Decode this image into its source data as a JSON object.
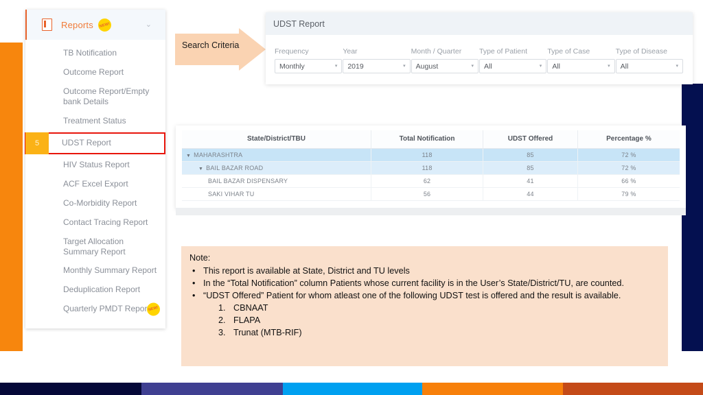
{
  "decor": {
    "left_bar_color": "#F7860D",
    "right_panel_color": "#041050",
    "bottom_strip_colors": [
      "#050838",
      "#3F3F91",
      "#00A0F0",
      "#F7800B",
      "#C44A18"
    ]
  },
  "sidebar": {
    "header": {
      "title": "Reports",
      "badge": "NEW!",
      "icon": "report-icon",
      "chevron": "⌄"
    },
    "items": [
      {
        "label": "TB Notification",
        "highlight": false
      },
      {
        "label": "Outcome Report",
        "highlight": false
      },
      {
        "label": "Outcome Report/Empty bank Details",
        "highlight": false
      },
      {
        "label": "Treatment Status",
        "highlight": false
      },
      {
        "label": "UDST Report",
        "highlight": true,
        "number": "5"
      },
      {
        "label": "HIV Status Report",
        "highlight": false
      },
      {
        "label": "ACF Excel Export",
        "highlight": false
      },
      {
        "label": "Co-Morbidity Report",
        "highlight": false
      },
      {
        "label": "Contact Tracing Report",
        "highlight": false
      },
      {
        "label": "Target Allocation Summary Report",
        "highlight": false
      },
      {
        "label": "Monthly Summary Report",
        "highlight": false
      },
      {
        "label": "Deduplication Report",
        "highlight": false
      },
      {
        "label": "Quarterly PMDT Report",
        "highlight": false,
        "badge": "NEW!"
      }
    ]
  },
  "annotation": {
    "search_criteria_label": "Search Criteria",
    "arrow_color": "#FAD3B2"
  },
  "report_card": {
    "title": "UDST Report",
    "filters": [
      {
        "label": "Frequency",
        "value": "Monthly"
      },
      {
        "label": "Year",
        "value": "2019"
      },
      {
        "label": "Month / Quarter",
        "value": "August"
      },
      {
        "label": "Type of Patient",
        "value": "All"
      },
      {
        "label": "Type of Case",
        "value": "All"
      },
      {
        "label": "Type of Disease",
        "value": "All"
      }
    ],
    "caret": "▾"
  },
  "table": {
    "columns": [
      "State/District/TBU",
      "Total Notification",
      "UDST Offered",
      "Percentage %"
    ],
    "rows": [
      {
        "name": "MAHARASHTRA",
        "level": 0,
        "expander": "▼",
        "total_notification": "118",
        "udst_offered": "85",
        "percentage": "72 %"
      },
      {
        "name": "BAIL BAZAR ROAD",
        "level": 1,
        "expander": "▼",
        "total_notification": "118",
        "udst_offered": "85",
        "percentage": "72 %"
      },
      {
        "name": "BAIL BAZAR DISPENSARY",
        "level": 2,
        "expander": "",
        "total_notification": "62",
        "udst_offered": "41",
        "percentage": "66 %"
      },
      {
        "name": "SAKI VIHAR TU",
        "level": 2,
        "expander": "",
        "total_notification": "56",
        "udst_offered": "44",
        "percentage": "79 %"
      }
    ]
  },
  "note": {
    "title": "Note:",
    "bullet_marker": "•",
    "bullets": [
      "This report is available at State, District and TU levels",
      "In the “Total Notification” column Patients whose current facility is in the User’s State/District/TU, are counted.",
      "“UDST Offered” Patient for whom atleast one of the following UDST test is offered and the result is available."
    ],
    "numbered": [
      {
        "n": "1.",
        "text": "CBNAAT"
      },
      {
        "n": "2.",
        "text": "FLAPA"
      },
      {
        "n": "3.",
        "text": "Trunat (MTB-RIF)"
      }
    ]
  }
}
